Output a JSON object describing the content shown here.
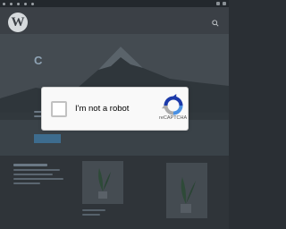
{
  "recaptcha": {
    "label": "I'm not a robot",
    "brand": "reCAPTCHA"
  },
  "icons": {
    "site_logo": "wordpress-logo",
    "search": "search-icon",
    "recaptcha_logo": "recaptcha-logo"
  },
  "colors": {
    "overlay_background": "#2a2f34",
    "widget_background": "#f9f9f9",
    "widget_border": "#d3d3d3"
  }
}
